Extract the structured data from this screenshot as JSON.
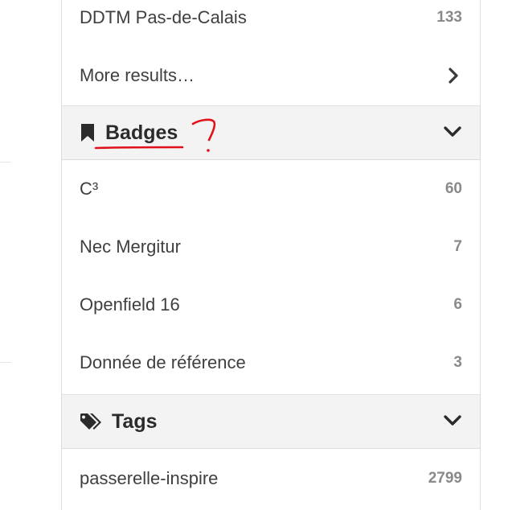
{
  "results_list": {
    "items": [
      {
        "label": "DDTM Pas-de-Calais",
        "count": "133"
      },
      {
        "label": "More results…"
      }
    ]
  },
  "badges": {
    "title": "Badges",
    "icon": "bookmark-icon",
    "items": [
      {
        "label": "C³",
        "count": "60"
      },
      {
        "label": "Nec Mergitur",
        "count": "7"
      },
      {
        "label": "Openfield 16",
        "count": "6"
      },
      {
        "label": "Donnée de référence",
        "count": "3"
      }
    ]
  },
  "tags": {
    "title": "Tags",
    "icon": "tags-icon",
    "items": [
      {
        "label": "passerelle-inspire",
        "count": "2799"
      }
    ]
  },
  "annotation": {
    "color": "#e0111b"
  },
  "colors": {
    "section_bg": "#f3f3f3",
    "count_text": "#8a8a8a",
    "label_text": "#3f3f3f"
  }
}
